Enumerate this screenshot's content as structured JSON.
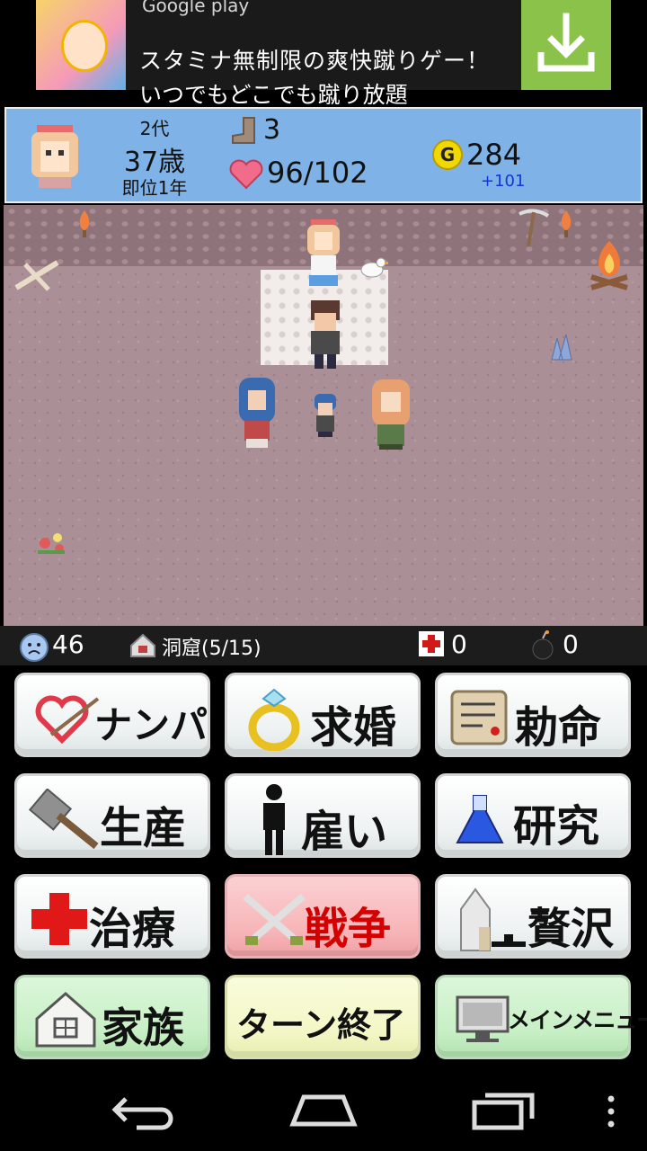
{
  "ad": {
    "store": "Google play",
    "headline": "スタミナ無制限の爽快蹴りゲー！",
    "subline": "いつでもどこでも蹴り放題",
    "download_icon": "download-icon"
  },
  "status": {
    "generation": "2代",
    "age": "37歳",
    "reign": "即位1年",
    "steps": "3",
    "hp": "96/102",
    "gold_symbol": "G",
    "gold": "284",
    "gold_income": "+101"
  },
  "infobar": {
    "mood_value": "46",
    "location": "洞窟(5/15)",
    "medical": "0",
    "bombs": "0"
  },
  "buttons": {
    "nanpa": "ナンパ",
    "kyukon": "求婚",
    "chokumei": "勅命",
    "seisan": "生産",
    "yatoi": "雇い",
    "kenkyu": "研究",
    "chiryo": "治療",
    "senso": "戦争",
    "zeitaku": "贅沢",
    "kazoku": "家族",
    "turn_end": "ターン終了",
    "main_menu": "メインメニュー"
  },
  "colors": {
    "status_bg": "#7fb2e6",
    "map_bg": "#aa8f96",
    "war_button": "#f7b5b8",
    "family_button": "#c7efc5",
    "turn_end_button": "#f3f7c6",
    "main_menu_button": "#c7efc5",
    "ad_download": "#8bc34a"
  }
}
